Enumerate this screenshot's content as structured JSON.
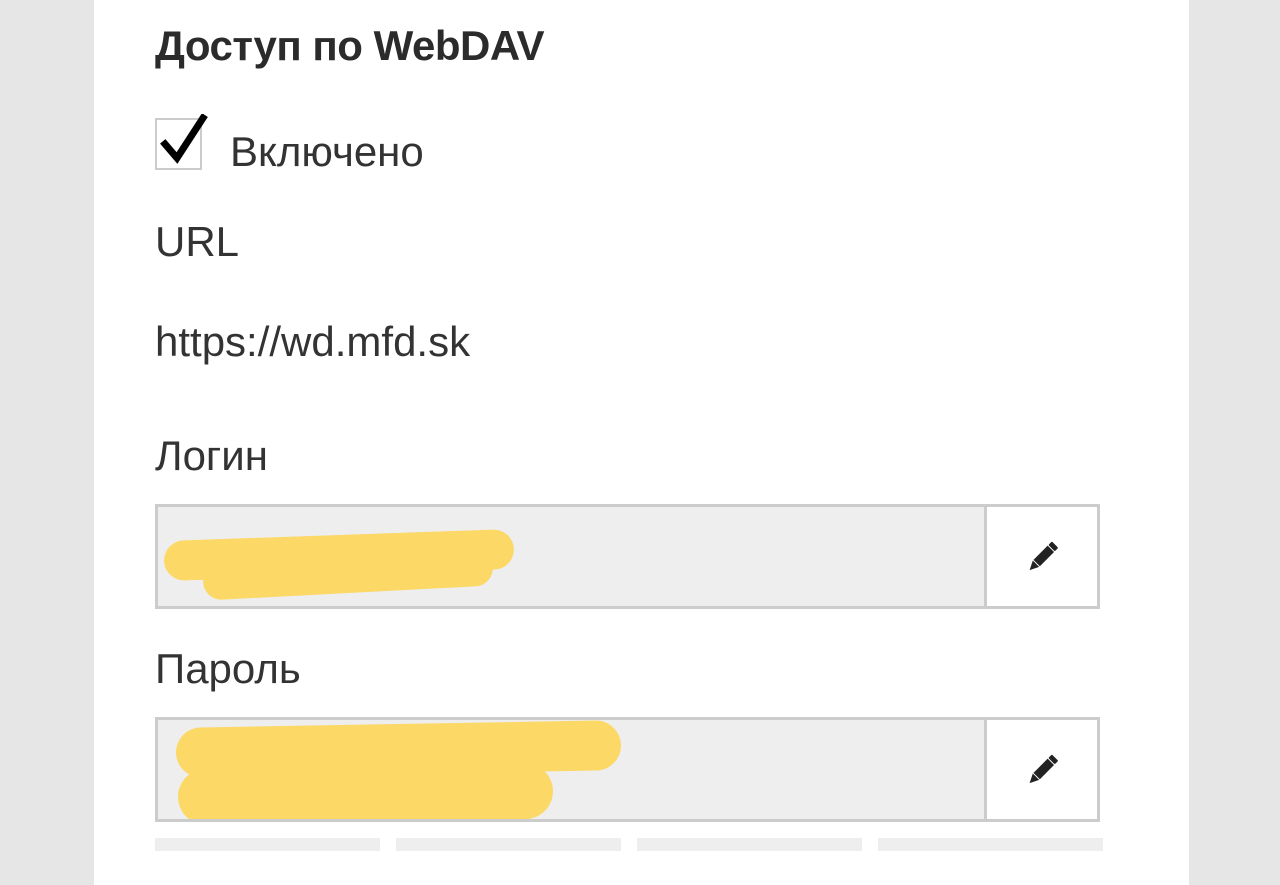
{
  "section": {
    "title": "Доступ по WebDAV"
  },
  "enabled": {
    "label": "Включено",
    "checked": true
  },
  "url": {
    "label": "URL",
    "value": "https://wd.mfd.sk"
  },
  "login": {
    "label": "Логин",
    "value_redacted": true,
    "edit_icon": "pencil-icon"
  },
  "password": {
    "label": "Пароль",
    "value_redacted": true,
    "edit_icon": "pencil-icon"
  },
  "colors": {
    "background": "#e6e6e6",
    "panel": "#ffffff",
    "text": "#333333",
    "field_bg": "#eeeeee",
    "border": "#cccccc",
    "redaction": "#fcd867"
  },
  "bottom_tabs": 4
}
